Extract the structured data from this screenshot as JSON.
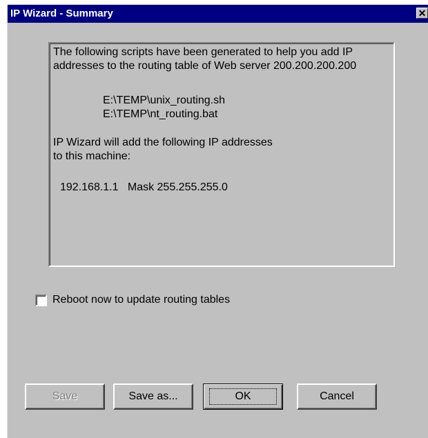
{
  "window": {
    "title": "IP Wizard - Summary",
    "close_glyph": "✕"
  },
  "summary": {
    "para1_line1": "The following scripts have been generated to help you add IP",
    "para1_line2": "addresses to the routing table of Web server 200.200.200.200",
    "scripts": [
      "E:\\TEMP\\unix_routing.sh",
      "E:\\TEMP\\nt_routing.bat"
    ],
    "para2_line1": "IP Wizard will add the following IP addresses",
    "para2_line2": "to this machine:",
    "ip_entry": "192.168.1.1   Mask 255.255.255.0"
  },
  "options": {
    "reboot_label": "Reboot now to update routing tables",
    "reboot_checked": false
  },
  "buttons": {
    "save": "Save",
    "save_as": "Save as...",
    "ok": "OK",
    "cancel": "Cancel"
  },
  "colors": {
    "titlebar": "#000080",
    "face": "#c0c0c0",
    "disabled_text": "#808080"
  }
}
